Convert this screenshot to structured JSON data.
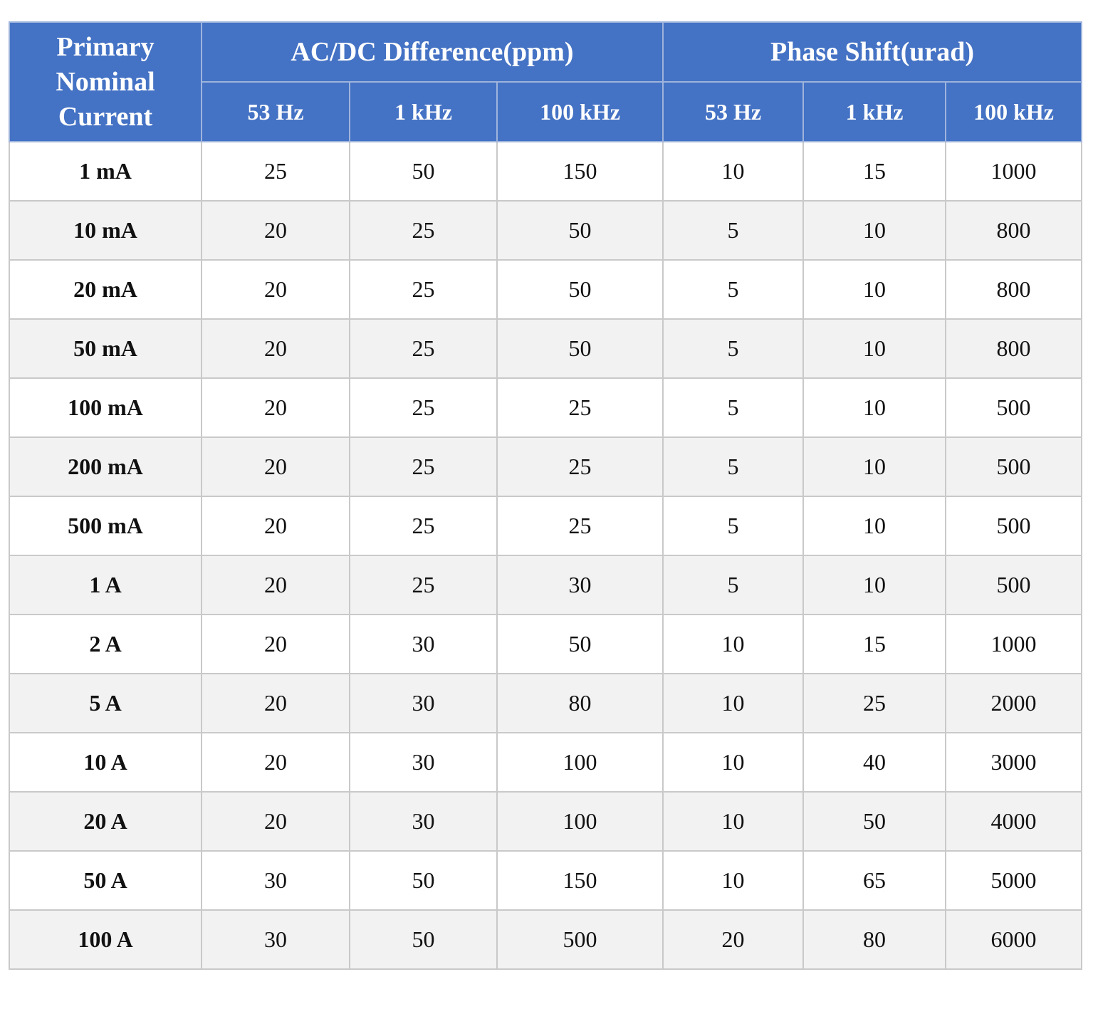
{
  "table": {
    "corner_header": [
      "Primary",
      "Nominal",
      "Current"
    ],
    "groups": [
      "AC/DC Difference(ppm)",
      "Phase Shift(urad)"
    ],
    "subheaders": [
      "53 Hz",
      "1 kHz",
      "100 kHz",
      "53 Hz",
      "1 kHz",
      "100 kHz"
    ],
    "header_color": "#4472C4",
    "alt_row_color": "#f2f2f2",
    "rows": [
      {
        "current": "1 mA",
        "values": [
          "25",
          "50",
          "150",
          "10",
          "15",
          "1000"
        ]
      },
      {
        "current": "10 mA",
        "values": [
          "20",
          "25",
          "50",
          "5",
          "10",
          "800"
        ]
      },
      {
        "current": "20 mA",
        "values": [
          "20",
          "25",
          "50",
          "5",
          "10",
          "800"
        ]
      },
      {
        "current": "50 mA",
        "values": [
          "20",
          "25",
          "50",
          "5",
          "10",
          "800"
        ]
      },
      {
        "current": "100 mA",
        "values": [
          "20",
          "25",
          "25",
          "5",
          "10",
          "500"
        ]
      },
      {
        "current": "200 mA",
        "values": [
          "20",
          "25",
          "25",
          "5",
          "10",
          "500"
        ]
      },
      {
        "current": "500 mA",
        "values": [
          "20",
          "25",
          "25",
          "5",
          "10",
          "500"
        ]
      },
      {
        "current": "1 A",
        "values": [
          "20",
          "25",
          "30",
          "5",
          "10",
          "500"
        ]
      },
      {
        "current": "2 A",
        "values": [
          "20",
          "30",
          "50",
          "10",
          "15",
          "1000"
        ]
      },
      {
        "current": "5 A",
        "values": [
          "20",
          "30",
          "80",
          "10",
          "25",
          "2000"
        ]
      },
      {
        "current": "10 A",
        "values": [
          "20",
          "30",
          "100",
          "10",
          "40",
          "3000"
        ]
      },
      {
        "current": "20 A",
        "values": [
          "20",
          "30",
          "100",
          "10",
          "50",
          "4000"
        ]
      },
      {
        "current": "50 A",
        "values": [
          "30",
          "50",
          "150",
          "10",
          "65",
          "5000"
        ]
      },
      {
        "current": "100 A",
        "values": [
          "30",
          "50",
          "500",
          "20",
          "80",
          "6000"
        ]
      }
    ]
  }
}
